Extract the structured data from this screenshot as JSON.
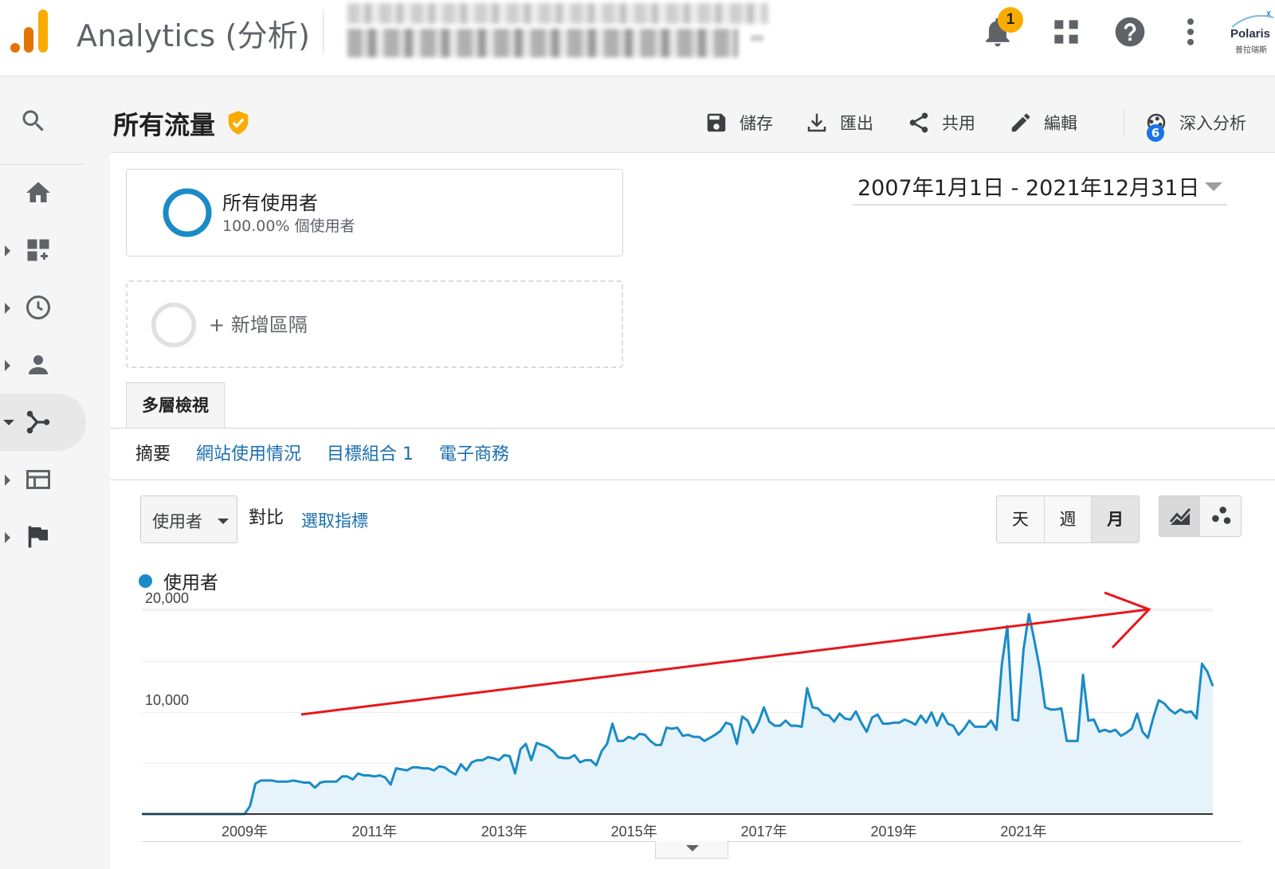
{
  "app": {
    "title": "Analytics (分析)",
    "notification_count": "1",
    "profile_name": "Polaris",
    "profile_sub": "普拉瑞斯"
  },
  "colors": {
    "ga_orange_dark": "#e37400",
    "ga_orange_light": "#f9ab00",
    "link_blue": "#1b6fae",
    "series_blue": "#1a8bc6",
    "area_fill": "#e6f3fa",
    "verified": "#f9ab00",
    "annotation_red": "#e8161b"
  },
  "sidebar": {
    "items": [
      {
        "icon": "search-icon"
      },
      {
        "icon": "home-icon"
      },
      {
        "icon": "customization-icon"
      },
      {
        "icon": "realtime-clock-icon"
      },
      {
        "icon": "audience-person-icon"
      },
      {
        "icon": "acquisition-icon",
        "active": true
      },
      {
        "icon": "behavior-icon"
      },
      {
        "icon": "conversions-flag-icon"
      }
    ]
  },
  "header": {
    "title": "所有流量",
    "actions": {
      "save": "儲存",
      "export": "匯出",
      "share": "共用",
      "edit": "編輯",
      "insights": "深入分析",
      "insights_count": "6"
    }
  },
  "segments": {
    "active_name": "所有使用者",
    "active_sub": "100.00% 個使用者",
    "add_label": "+ 新增區隔"
  },
  "date_range": "2007年1月1日 - 2021年12月31日",
  "explorer": {
    "tab": "多層檢視",
    "subtabs": {
      "summary": "摘要",
      "site_usage": "網站使用情況",
      "goal_set": "目標組合 1",
      "ecommerce": "電子商務"
    }
  },
  "controls": {
    "metric": "使用者",
    "vs": "對比",
    "pick_metric": "選取指標",
    "periods": {
      "day": "天",
      "week": "週",
      "month": "月"
    },
    "active_period": "month"
  },
  "chart_data": {
    "type": "area",
    "legend": "使用者",
    "series": [
      {
        "name": "使用者",
        "x_start": "2007-06",
        "interval": "month",
        "values": [
          0,
          0,
          0,
          0,
          0,
          0,
          0,
          0,
          0,
          0,
          0,
          0,
          0,
          0,
          0,
          0,
          0,
          0,
          0,
          0,
          800,
          3000,
          3300,
          3300,
          3300,
          3200,
          3200,
          3200,
          3300,
          3200,
          3100,
          3100,
          2600,
          3100,
          3200,
          3200,
          3200,
          3700,
          3700,
          3400,
          4000,
          3800,
          3800,
          3700,
          3800,
          3600,
          2900,
          4500,
          4400,
          4300,
          4600,
          4600,
          4500,
          4500,
          4300,
          4700,
          4600,
          4200,
          3900,
          4900,
          4300,
          5100,
          5300,
          5300,
          5600,
          5500,
          5300,
          5800,
          5700,
          4000,
          6400,
          6900,
          5300,
          7000,
          6800,
          6600,
          6200,
          5600,
          5500,
          5500,
          5800,
          5100,
          5300,
          5300,
          4800,
          6200,
          6900,
          8900,
          7200,
          7200,
          7600,
          7400,
          7900,
          7800,
          7200,
          6800,
          6800,
          8500,
          8400,
          8500,
          7700,
          7800,
          7600,
          7600,
          7200,
          7500,
          7800,
          8200,
          9000,
          8800,
          6900,
          9600,
          9200,
          8000,
          9000,
          10500,
          9100,
          8700,
          8700,
          9200,
          8700,
          8700,
          8600,
          12400,
          10500,
          10400,
          9800,
          9700,
          9100,
          9900,
          9400,
          9300,
          10100,
          9000,
          8100,
          9500,
          9800,
          8900,
          8900,
          9000,
          9000,
          9300,
          9100,
          8800,
          9700,
          9000,
          10000,
          8700,
          9900,
          8900,
          8700,
          7800,
          8400,
          9200,
          8600,
          8600,
          8600,
          9200,
          8300,
          14800,
          18500,
          9300,
          9200,
          16200,
          19700,
          17100,
          14300,
          10500,
          10300,
          10300,
          10400,
          7200,
          7200,
          7200,
          13700,
          9200,
          9300,
          8100,
          8300,
          8100,
          8300,
          7700,
          8000,
          8400,
          9900,
          8100,
          7500,
          9500,
          11200,
          10900,
          10300,
          9900,
          10300,
          10000,
          10100,
          9400,
          14800,
          14000,
          12600
        ]
      }
    ],
    "y_ticks": [
      "20,000",
      "10,000"
    ],
    "ylim": [
      0,
      20000
    ],
    "x_ticks": [
      "2009年",
      "2011年",
      "2013年",
      "2015年",
      "2017年",
      "2019年",
      "2021年"
    ],
    "annotation": "red upward trend arrow",
    "grid": true
  }
}
